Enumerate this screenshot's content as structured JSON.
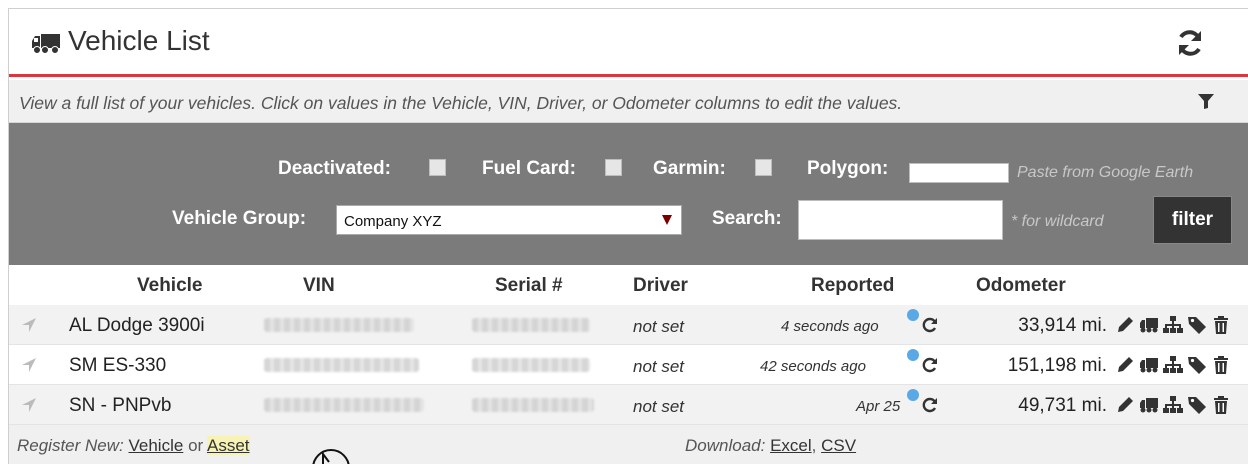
{
  "header": {
    "title": "Vehicle List",
    "title_icon": "truck-icon",
    "refresh_icon": "refresh-icon"
  },
  "description": {
    "text": "View a full list of your vehicles. Click on values in the Vehicle, VIN, Driver, or Odometer columns to edit the values.",
    "filter_icon": "funnel-icon"
  },
  "filters": {
    "deactivated_label": "Deactivated:",
    "fuel_card_label": "Fuel Card:",
    "garmin_label": "Garmin:",
    "polygon_label": "Polygon:",
    "polygon_hint": "Paste from Google Earth",
    "vehicle_group_label": "Vehicle Group:",
    "vehicle_group_value": "Company XYZ",
    "search_label": "Search:",
    "search_value": "",
    "search_hint": "* for wildcard",
    "filter_button": "filter"
  },
  "table": {
    "columns": [
      "Vehicle",
      "VIN",
      "Serial #",
      "Driver",
      "Reported",
      "Odometer"
    ],
    "rows": [
      {
        "vehicle": "AL Dodge 3900i",
        "driver": "not set",
        "reported": "4 seconds ago",
        "odometer": "33,914 mi."
      },
      {
        "vehicle": "SM ES-330",
        "driver": "not set",
        "reported": "42 seconds ago",
        "odometer": "151,198 mi."
      },
      {
        "vehicle": "SN - PNPvb",
        "driver": "not set",
        "reported": "Apr 25",
        "odometer": "49,731 mi."
      }
    ],
    "row_actions": [
      "pencil-icon",
      "truck-icon",
      "sitemap-icon",
      "tag-icon",
      "trash-icon"
    ]
  },
  "footer": {
    "register_prefix": "Register New:",
    "vehicle_link": "Vehicle",
    "or_text": "or",
    "asset_link": "Asset",
    "download_prefix": "Download:",
    "excel_link": "Excel",
    "comma": ",",
    "csv_link": "CSV"
  },
  "colors": {
    "accent_red": "#d9363e",
    "filter_bg": "#7b7b7b",
    "info_blue": "#5aa9e6"
  }
}
